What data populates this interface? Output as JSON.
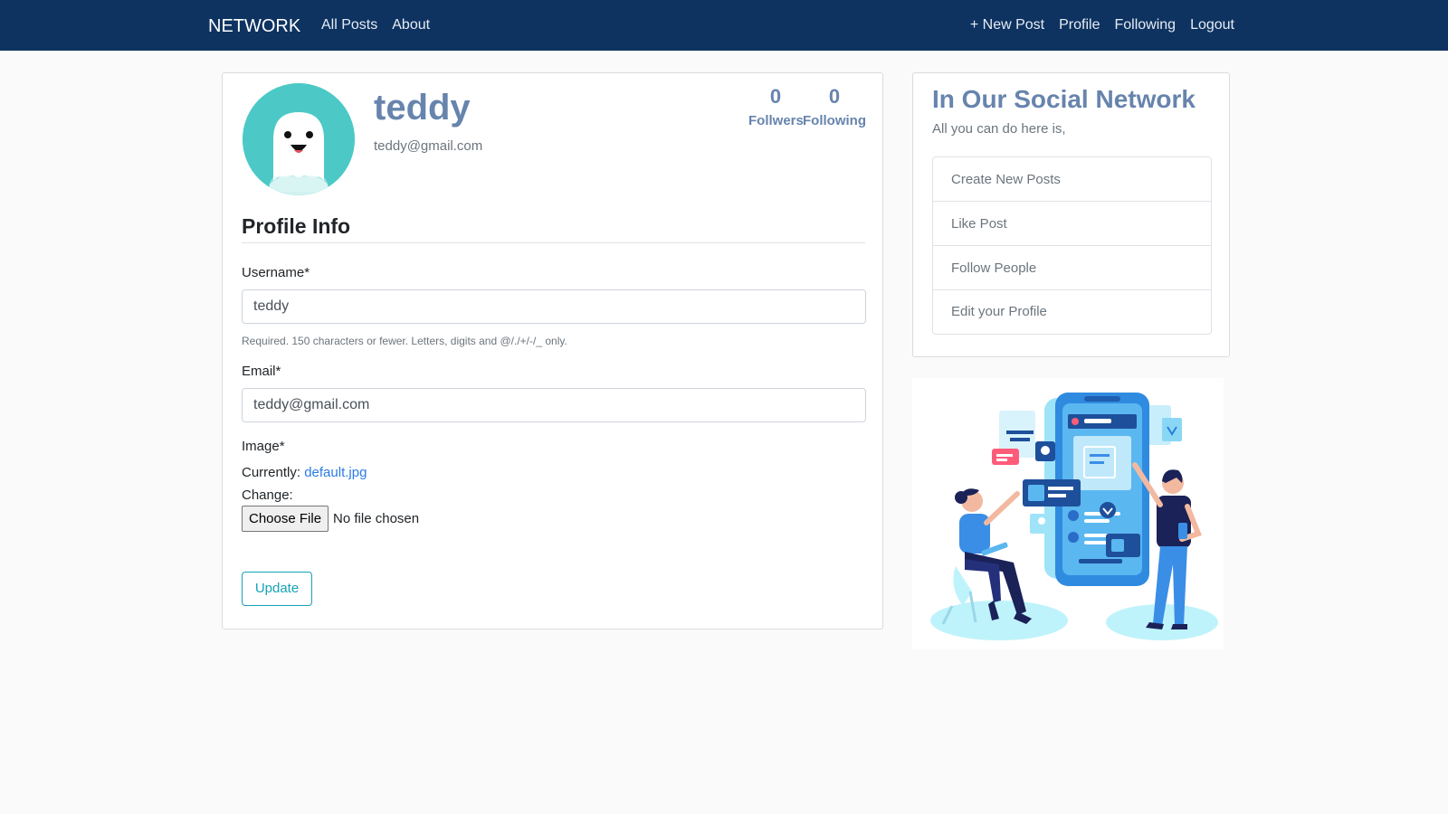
{
  "navbar": {
    "brand": "NETWORK",
    "left_links": [
      "All Posts",
      "About"
    ],
    "right_links": [
      "+ New Post",
      "Profile",
      "Following",
      "Logout"
    ],
    "background_color": "#0e3361"
  },
  "profile": {
    "username": "teddy",
    "email": "teddy@gmail.com",
    "followers_count": "0",
    "followers_label": "Follwers",
    "following_count": "0",
    "following_label": "Following",
    "avatar_icon": "ghost-avatar-icon"
  },
  "form": {
    "section_title": "Profile Info",
    "username_label": "Username*",
    "username_value": "teddy",
    "username_help": "Required. 150 characters or fewer. Letters, digits and @/./+/-/_ only.",
    "email_label": "Email*",
    "email_value": "teddy@gmail.com",
    "image_label": "Image*",
    "currently_label": "Currently:",
    "current_file": "default.jpg",
    "change_label": "Change:",
    "file_button": "Choose File",
    "file_status": "No file chosen",
    "submit_label": "Update"
  },
  "sidebar": {
    "title": "In Our Social Network",
    "subtitle": "All you can do here is,",
    "features": [
      "Create New Posts",
      "Like Post",
      "Follow People",
      "Edit your Profile"
    ]
  },
  "colors": {
    "accent": "#6784ad",
    "link": "#2c7be5",
    "button_outline": "#17a2b8",
    "avatar_bg": "#4cc9c6"
  }
}
